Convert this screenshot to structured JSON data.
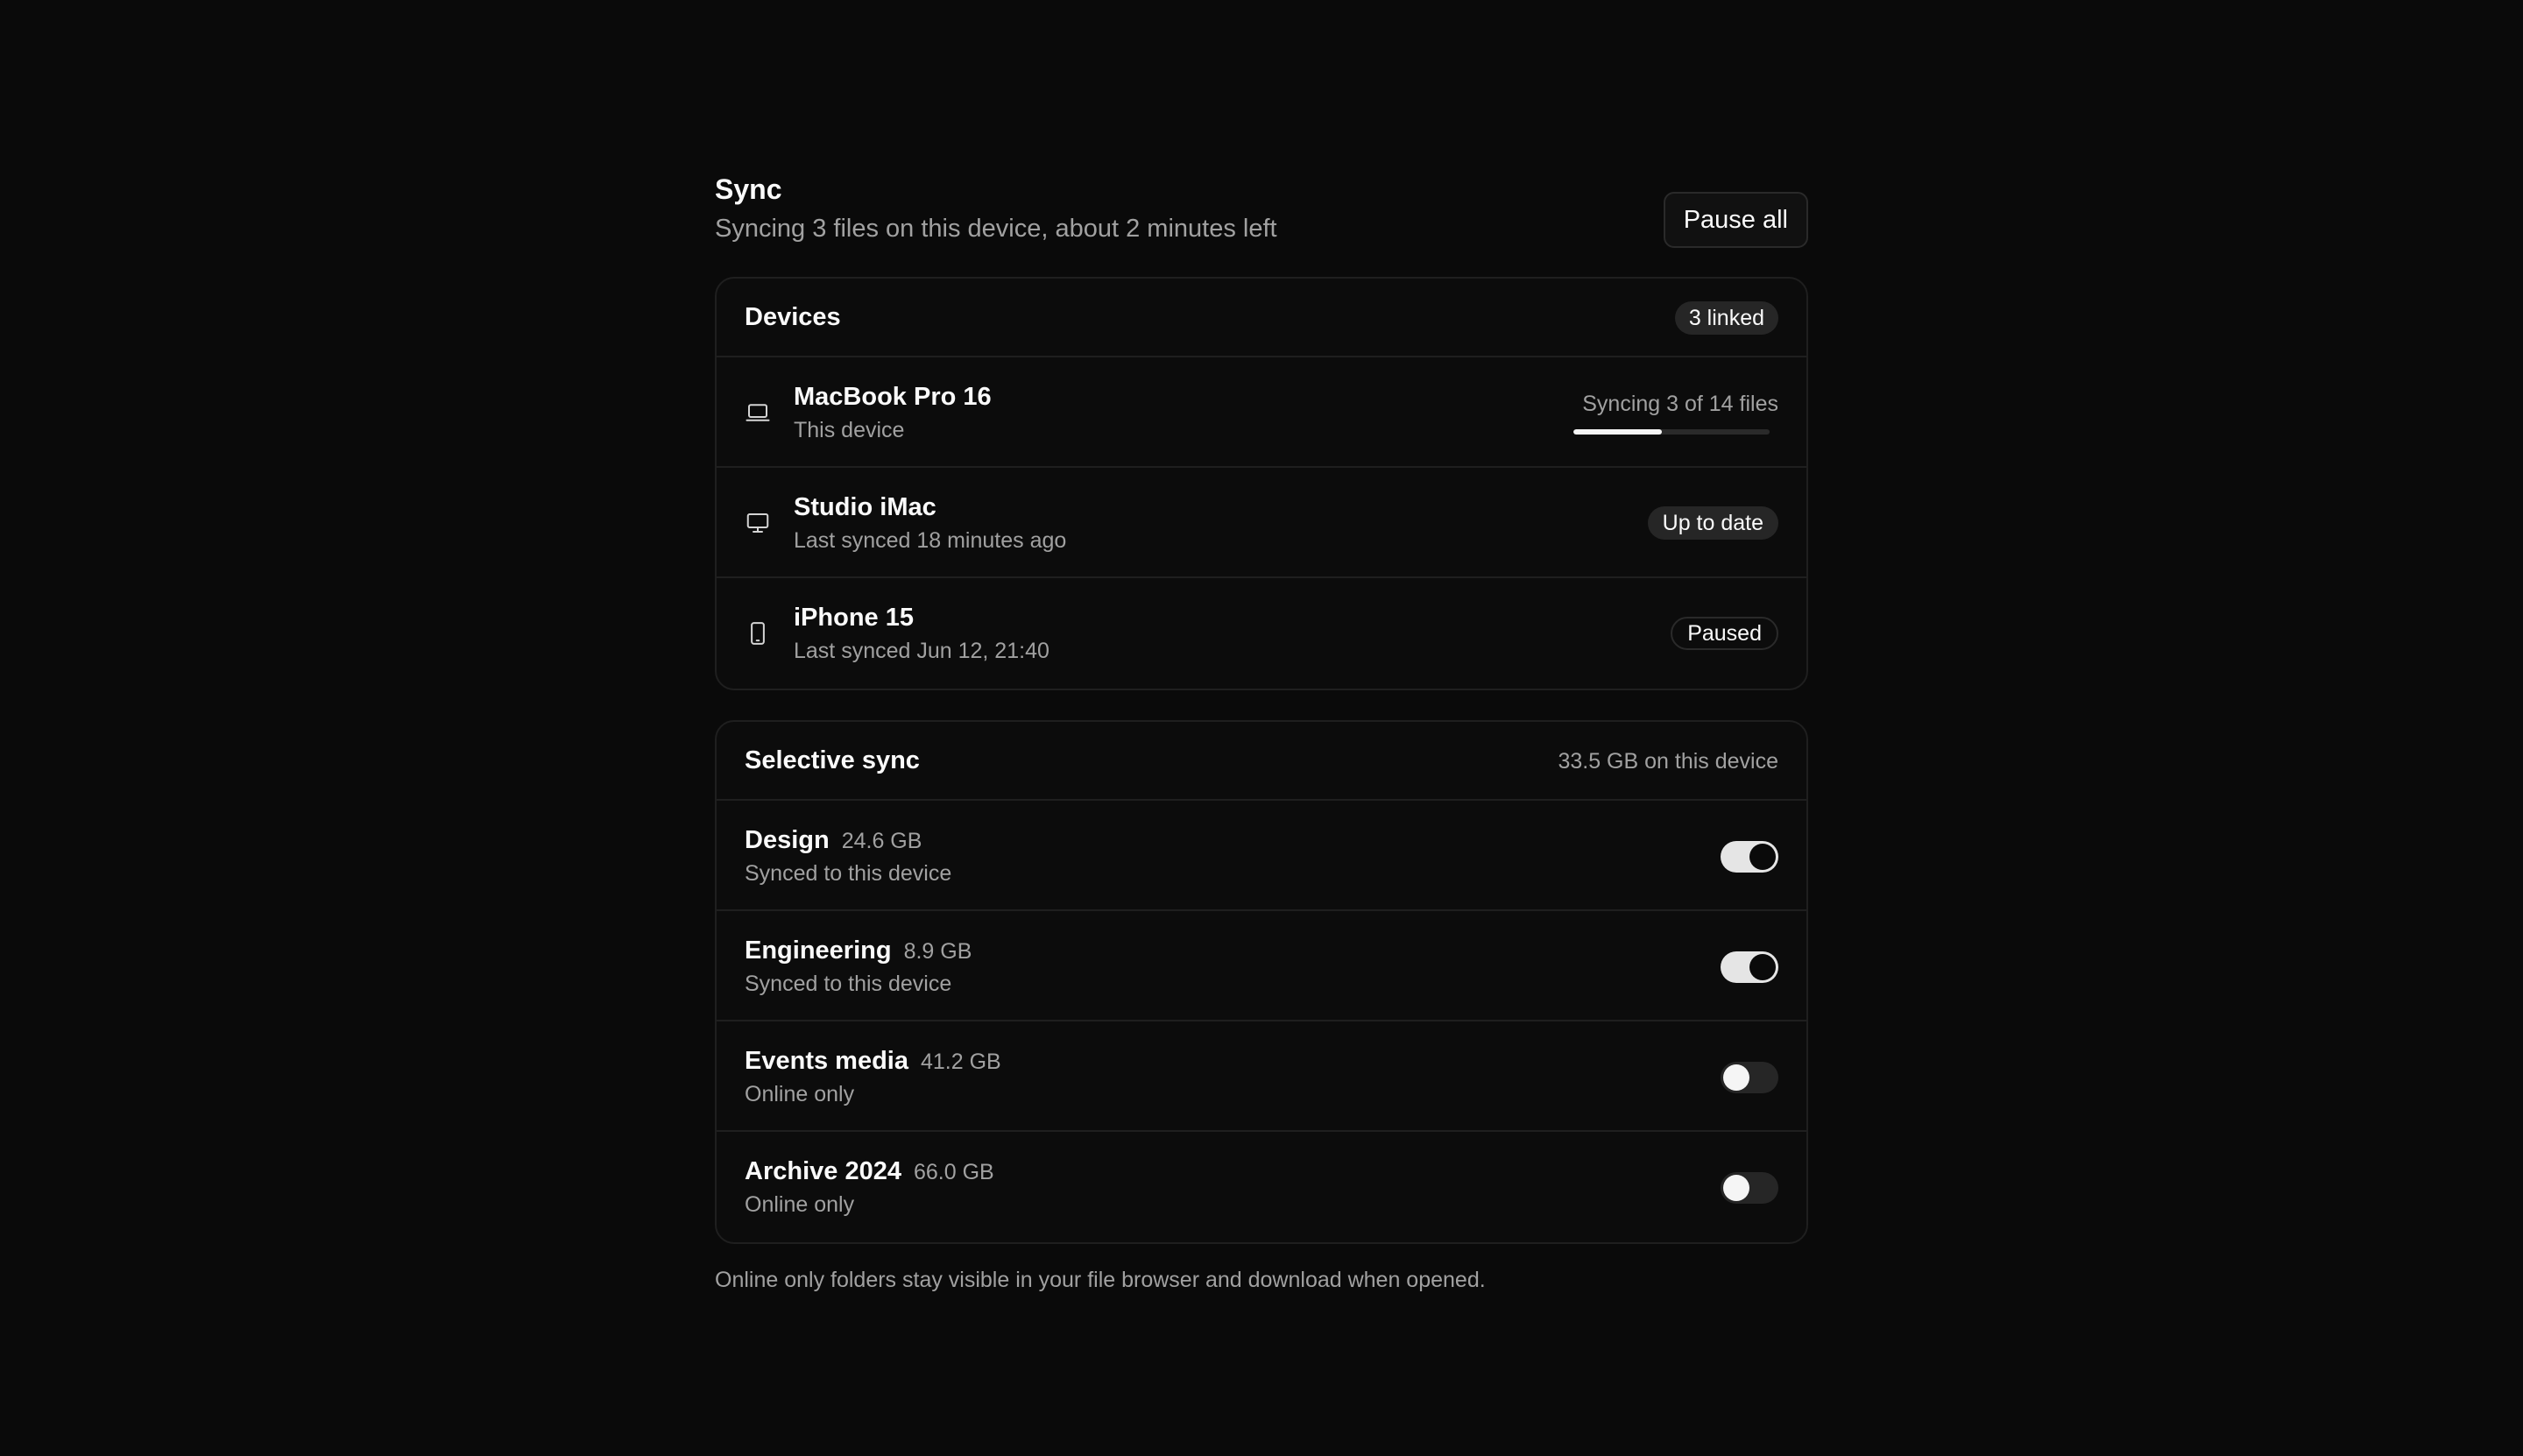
{
  "header": {
    "title": "Sync",
    "subtitle": "Syncing 3 files on this device, about 2 minutes left",
    "pause_label": "Pause all"
  },
  "devices": {
    "title": "Devices",
    "count_label": "3 linked",
    "items": [
      {
        "name": "MacBook Pro 16",
        "sub": "This device",
        "icon": "laptop-icon",
        "status": "Syncing 3 of 14 files",
        "progress": 0.45
      },
      {
        "name": "Studio iMac",
        "sub": "Last synced 18 minutes ago",
        "icon": "monitor-icon",
        "status": "Up to date"
      },
      {
        "name": "iPhone 15",
        "sub": "Last synced Jun 12, 21:40",
        "icon": "phone-icon",
        "status": "Paused"
      }
    ]
  },
  "selective": {
    "title": "Selective sync",
    "storage": "33.5 GB on this device",
    "folders": [
      {
        "name": "Design",
        "size": "24.6 GB",
        "sub": "Synced to this device",
        "enabled": true
      },
      {
        "name": "Engineering",
        "size": "8.9 GB",
        "sub": "Synced to this device",
        "enabled": true
      },
      {
        "name": "Events media",
        "size": "41.2 GB",
        "sub": "Online only",
        "enabled": false
      },
      {
        "name": "Archive 2024",
        "size": "66.0 GB",
        "sub": "Online only",
        "enabled": false
      }
    ]
  },
  "footnote": "Online only folders stay visible in your file browser and download when opened.",
  "colors": {
    "background": "#0a0a0a",
    "text": "#fafafa",
    "muted": "#a1a1a1",
    "border": "#1f1f1f",
    "toggle_on": "#e5e5e5"
  }
}
